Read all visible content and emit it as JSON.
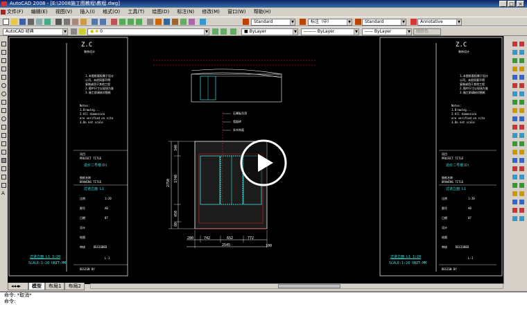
{
  "titlebar": {
    "title": "AutoCAD 2008 - [E:\\2008施工图教程\\教程.dwg]"
  },
  "menu": {
    "items": [
      "文件(F)",
      "编辑(E)",
      "视图(V)",
      "插入(I)",
      "格式(O)",
      "工具(T)",
      "绘图(D)",
      "标注(N)",
      "修改(M)",
      "窗口(W)",
      "帮助(H)"
    ]
  },
  "toolbar": {
    "text_style": "Standard",
    "dim_style": "标注（中）",
    "table_style": "Standard",
    "annotative": "Annotative",
    "workspace": "AutoCAD 经典",
    "layer": "0",
    "color": "ByLayer",
    "linetype": "ByLayer",
    "lineweight": "ByLayer",
    "plotstyle": "随颜色"
  },
  "left_sheet": {
    "logo": "Z.C",
    "logo_sub": "装饰设计",
    "notes": [
      "1.本图纸版权属于设计",
      "公司，未经同意不得",
      "复制或用于其他工程",
      "2.图中尺寸以现场为准",
      "3.施工前请核对图纸",
      "Notes:",
      "1.Drawing...",
      "2.All dimension",
      "are verified on site",
      "3.Do not scale"
    ],
    "project_title": "项目",
    "project_en": "PROJECT TITLE",
    "project_name": "造价二号楼(D)",
    "drawing_title": "图纸名称",
    "drawing_en": "DRAWING TITLE",
    "drawing_name": "过道立面 L1",
    "fields": [
      {
        "k": "比例",
        "v": "1:20"
      },
      {
        "k": "图号",
        "v": "A0"
      },
      {
        "k": "日期",
        "v": "07"
      },
      {
        "k": "设计",
        "v": ""
      },
      {
        "k": "绘图",
        "v": ""
      },
      {
        "k": "审核",
        "v": "DESIGNED"
      }
    ],
    "sheet_code": "L-1",
    "scale_label": "过道立面 L1  1:20",
    "scale_en": "SCALE:1:20  UNIT:MM",
    "bottom_note": "DESIGN BY"
  },
  "right_sheet": {
    "logo": "Z.C",
    "logo_sub": "装饰设计",
    "project_name": "造价二号楼(D)",
    "drawing_name": "过道立面 L1",
    "scale_label": "过道立面 L1  1:20",
    "scale_en": "SCALE:1:20  UNIT:MM",
    "bottom_note": "DESIGN BY"
  },
  "drawing": {
    "callouts": [
      "石膏板吊顶",
      "墙面砖",
      "实木饰面"
    ],
    "dim_bottom_parts": [
      "280",
      "742",
      "652",
      "772"
    ],
    "dim_bottom_total": "2545",
    "dim_bottom_extra": "100",
    "dim_left_total": "2750",
    "dim_left_parts": [
      "340",
      "1740",
      "450",
      "80"
    ]
  },
  "tabs": {
    "model": "模型",
    "layout1": "布局1",
    "layout2": "布局2"
  },
  "command": {
    "line1": "命令: *取消*",
    "line2": "命令:"
  },
  "colors": {
    "canvas": "#000000",
    "cyan": "#3fe0e0",
    "chrome": "#d4d0c8",
    "title_blue": "#0a246a",
    "red": "#ff2020"
  },
  "video_overlay": {
    "icon": "play-icon"
  }
}
